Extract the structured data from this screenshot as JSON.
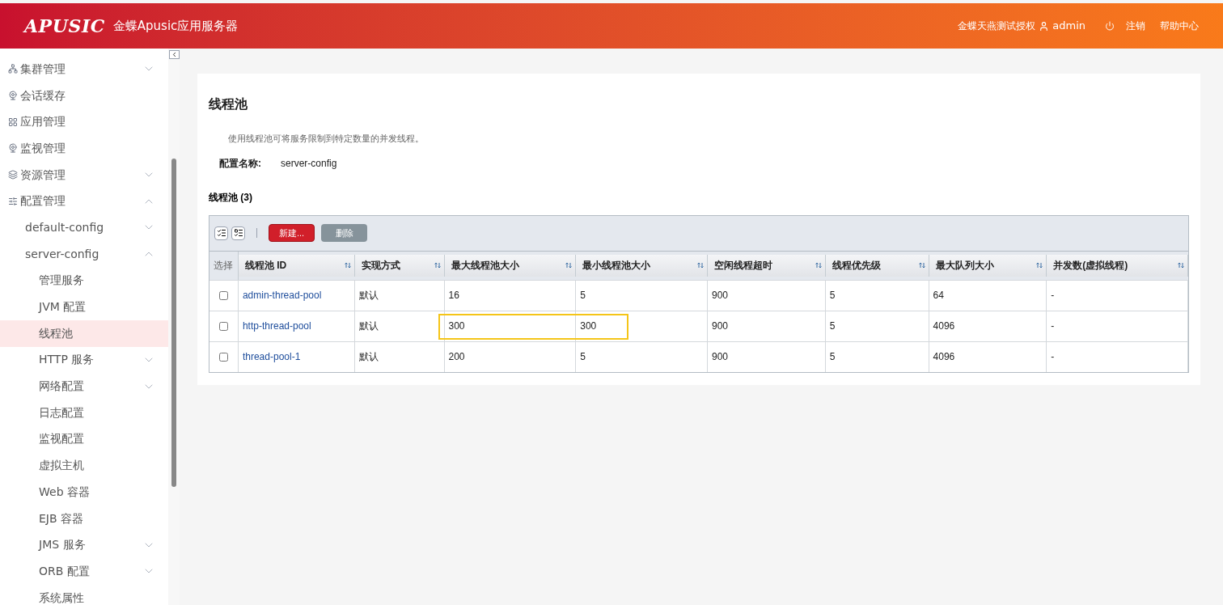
{
  "header": {
    "logo": "APUSIC",
    "product": "金蝶Apusic应用服务器",
    "license": "金蝶天燕测试授权",
    "user": "admin",
    "logout": "注销",
    "help": "帮助中心"
  },
  "sidebar": {
    "items": [
      {
        "label": "集群管理",
        "expanded": false
      },
      {
        "label": "会话缓存"
      },
      {
        "label": "应用管理"
      },
      {
        "label": "监视管理"
      },
      {
        "label": "资源管理",
        "expanded": false
      },
      {
        "label": "配置管理",
        "expanded": true,
        "children": [
          {
            "label": "default-config",
            "expanded": false
          },
          {
            "label": "server-config",
            "expanded": true,
            "children": [
              {
                "label": "管理服务",
                "selected": false
              },
              {
                "label": "JVM 配置",
                "selected": false
              },
              {
                "label": "线程池",
                "selected": true
              },
              {
                "label": "HTTP 服务",
                "selected": false,
                "expanded": false
              },
              {
                "label": "网络配置",
                "selected": false,
                "expanded": false
              },
              {
                "label": "日志配置",
                "selected": false
              },
              {
                "label": "监视配置",
                "selected": false
              },
              {
                "label": "虚拟主机",
                "selected": false
              },
              {
                "label": "Web 容器",
                "selected": false
              },
              {
                "label": "EJB 容器",
                "selected": false
              },
              {
                "label": "JMS 服务",
                "selected": false,
                "expanded": false
              },
              {
                "label": "ORB 配置",
                "selected": false,
                "expanded": false
              },
              {
                "label": "系统属性",
                "selected": false
              }
            ]
          }
        ]
      }
    ]
  },
  "page": {
    "title": "线程池",
    "description": "使用线程池可将服务限制到特定数量的并发线程。",
    "config_label": "配置名称:",
    "config_value": "server-config"
  },
  "table": {
    "title": "线程池 (3)",
    "new_button": "新建...",
    "delete_button": "删除",
    "select_header": "选择",
    "columns": [
      "线程池 ID",
      "实现方式",
      "最大线程池大小",
      "最小线程池大小",
      "空闲线程超时",
      "线程优先级",
      "最大队列大小",
      "并发数(虚拟线程)"
    ],
    "rows": [
      {
        "checked": false,
        "highlighted": false,
        "cells": [
          "admin-thread-pool",
          "默认",
          "16",
          "5",
          "900",
          "5",
          "64",
          "-"
        ]
      },
      {
        "checked": false,
        "highlighted": true,
        "cells": [
          "http-thread-pool",
          "默认",
          "300",
          "300",
          "900",
          "5",
          "4096",
          "-"
        ]
      },
      {
        "checked": false,
        "highlighted": false,
        "cells": [
          "thread-pool-1",
          "默认",
          "200",
          "5",
          "900",
          "5",
          "4096",
          "-"
        ]
      }
    ]
  }
}
